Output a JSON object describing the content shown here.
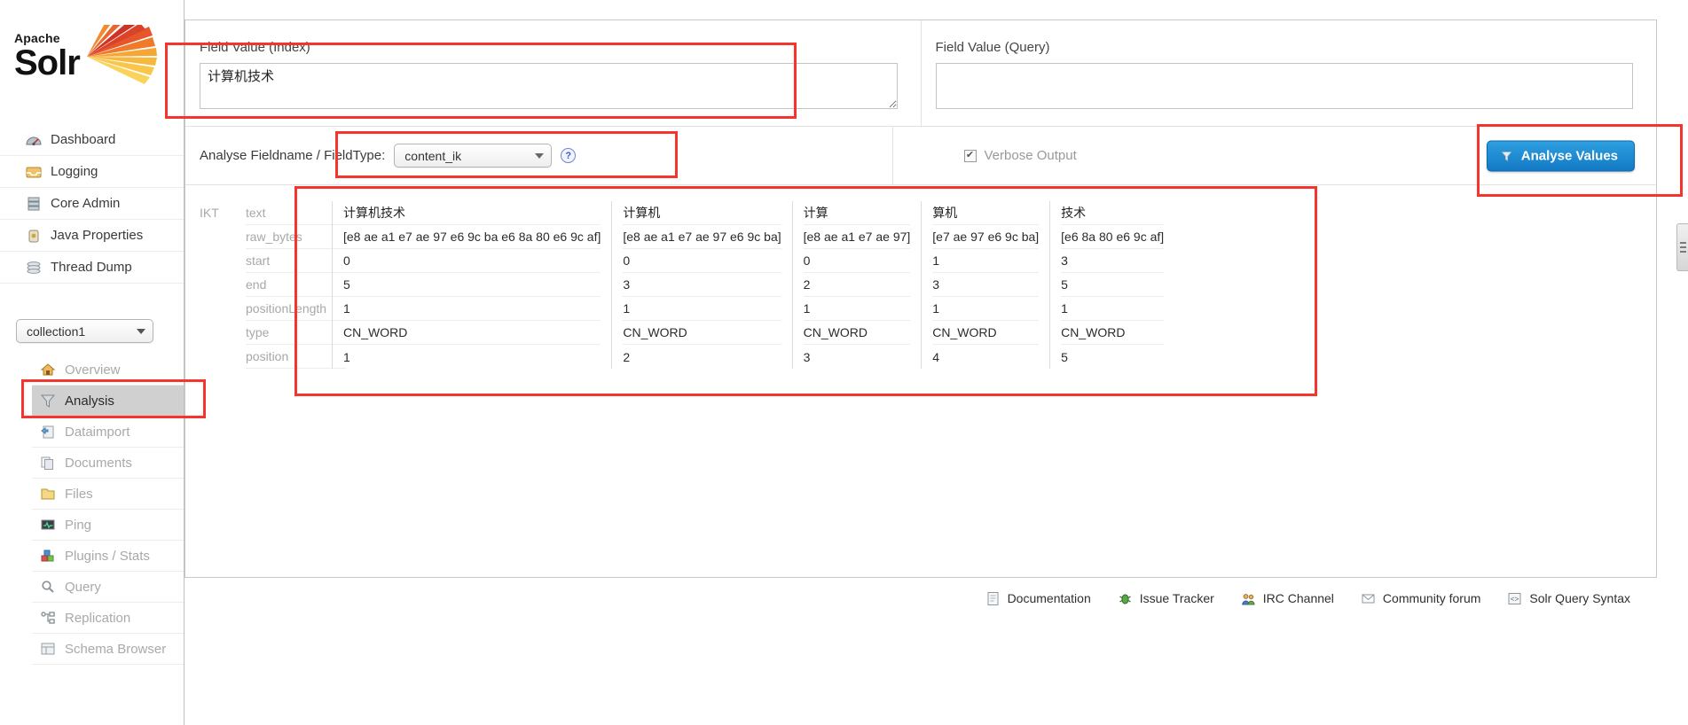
{
  "brand": {
    "apache": "Apache",
    "solr": "Solr",
    "logo_icon": "solr-sunburst-logo"
  },
  "sidebar": {
    "top_items": [
      {
        "label": "Dashboard",
        "icon": "dashboard-gauge-icon"
      },
      {
        "label": "Logging",
        "icon": "logging-inbox-icon"
      },
      {
        "label": "Core Admin",
        "icon": "core-admin-server-icon"
      },
      {
        "label": "Java Properties",
        "icon": "java-properties-icon"
      },
      {
        "label": "Thread Dump",
        "icon": "thread-dump-stack-icon"
      }
    ],
    "collection_selected": "collection1",
    "core_items": [
      {
        "label": "Overview",
        "icon": "overview-home-icon",
        "active": false
      },
      {
        "label": "Analysis",
        "icon": "analysis-funnel-icon",
        "active": true
      },
      {
        "label": "Dataimport",
        "icon": "dataimport-icon",
        "active": false
      },
      {
        "label": "Documents",
        "icon": "documents-icon",
        "active": false
      },
      {
        "label": "Files",
        "icon": "files-folder-icon",
        "active": false
      },
      {
        "label": "Ping",
        "icon": "ping-monitor-icon",
        "active": false
      },
      {
        "label": "Plugins / Stats",
        "icon": "plugins-blocks-icon",
        "active": false
      },
      {
        "label": "Query",
        "icon": "query-magnifier-icon",
        "active": false
      },
      {
        "label": "Replication",
        "icon": "replication-nodes-icon",
        "active": false
      },
      {
        "label": "Schema Browser",
        "icon": "schema-browser-icon",
        "active": false
      }
    ]
  },
  "form": {
    "index_label": "Field Value (Index)",
    "index_value": "计算机技术",
    "index_placeholder": "",
    "query_label": "Field Value (Query)",
    "query_value": "",
    "query_placeholder": "",
    "fieldtype_label": "Analyse Fieldname / FieldType:",
    "fieldtype_selected": "content_ik",
    "help_icon": "help-question-icon",
    "verbose_label": "Verbose Output",
    "verbose_checked": "✔",
    "analyse_button": "Analyse Values",
    "analyse_button_icon": "funnel-icon",
    "accent_color": "#1279c4",
    "annotation_color": "#f5342e"
  },
  "results": {
    "analyzer": "IKT",
    "row_labels": [
      "text",
      "raw_bytes",
      "start",
      "end",
      "positionLength",
      "type",
      "position"
    ],
    "tokens": [
      {
        "text": "计算机技术",
        "raw_bytes": "[e8 ae a1 e7 ae 97 e6 9c ba e6 8a 80 e6 9c af]",
        "start": "0",
        "end": "5",
        "positionLength": "1",
        "type": "CN_WORD",
        "position": "1"
      },
      {
        "text": "计算机",
        "raw_bytes": "[e8 ae a1 e7 ae 97 e6 9c ba]",
        "start": "0",
        "end": "3",
        "positionLength": "1",
        "type": "CN_WORD",
        "position": "2"
      },
      {
        "text": "计算",
        "raw_bytes": "[e8 ae a1 e7 ae 97]",
        "start": "0",
        "end": "2",
        "positionLength": "1",
        "type": "CN_WORD",
        "position": "3"
      },
      {
        "text": "算机",
        "raw_bytes": "[e7 ae 97 e6 9c ba]",
        "start": "1",
        "end": "3",
        "positionLength": "1",
        "type": "CN_WORD",
        "position": "4"
      },
      {
        "text": "技术",
        "raw_bytes": "[e6 8a 80 e6 9c af]",
        "start": "3",
        "end": "5",
        "positionLength": "1",
        "type": "CN_WORD",
        "position": "5"
      }
    ]
  },
  "footer": {
    "links": [
      {
        "label": "Documentation",
        "icon": "document-page-icon"
      },
      {
        "label": "Issue Tracker",
        "icon": "bug-icon"
      },
      {
        "label": "IRC Channel",
        "icon": "people-icon"
      },
      {
        "label": "Community forum",
        "icon": "envelope-icon"
      },
      {
        "label": "Solr Query Syntax",
        "icon": "code-brackets-icon"
      }
    ]
  }
}
